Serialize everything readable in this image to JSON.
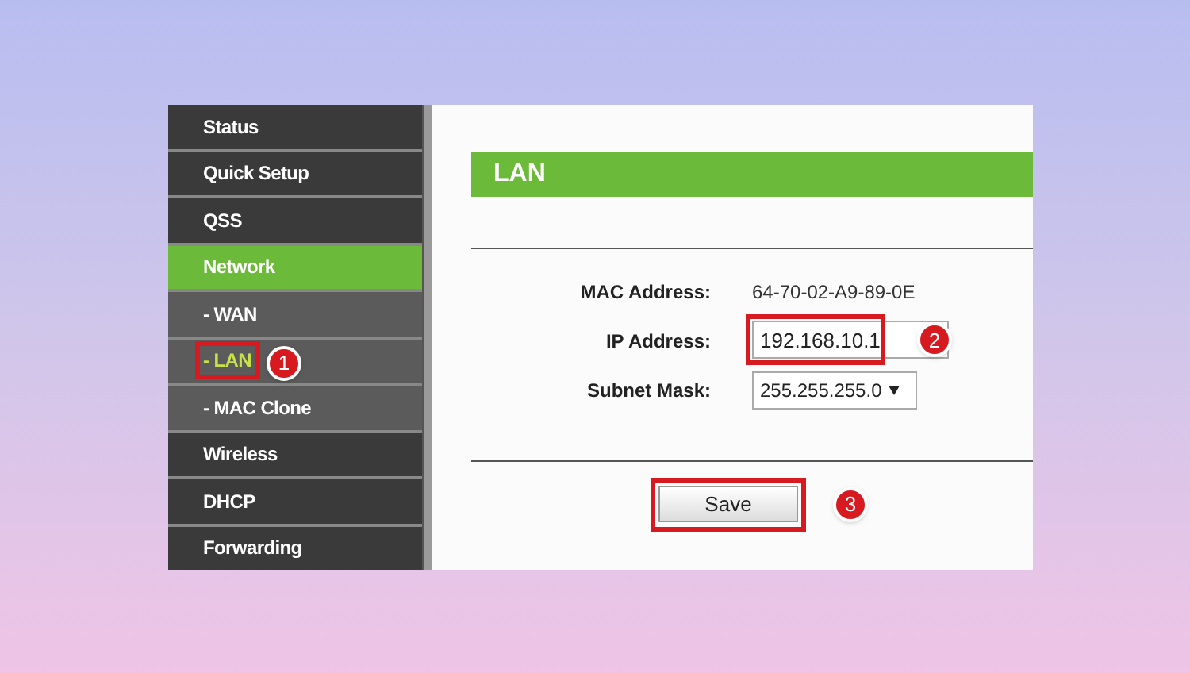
{
  "sidebar": {
    "items": [
      {
        "label": "Status",
        "kind": "main",
        "selected": false
      },
      {
        "label": "Quick Setup",
        "kind": "main",
        "selected": false
      },
      {
        "label": "QSS",
        "kind": "main",
        "selected": false
      },
      {
        "label": "Network",
        "kind": "main",
        "selected": true
      },
      {
        "label": "- WAN",
        "kind": "sub",
        "selected": false
      },
      {
        "label": "- LAN",
        "kind": "sub",
        "selected": true,
        "callout": "1"
      },
      {
        "label": "- MAC Clone",
        "kind": "sub",
        "selected": false
      },
      {
        "label": "Wireless",
        "kind": "main",
        "selected": false
      },
      {
        "label": "DHCP",
        "kind": "main",
        "selected": false
      },
      {
        "label": "Forwarding",
        "kind": "main",
        "selected": false
      }
    ]
  },
  "section_title": "LAN",
  "fields": [
    {
      "label": "MAC Address:",
      "kind": "text",
      "value": "64-70-02-A9-89-0E"
    },
    {
      "label": "IP Address:",
      "kind": "input",
      "value": "192.168.10.1",
      "callout": "2"
    },
    {
      "label": "Subnet Mask:",
      "kind": "select",
      "value": "255.255.255.0"
    }
  ],
  "save_button": {
    "label": "Save",
    "callout": "3"
  }
}
